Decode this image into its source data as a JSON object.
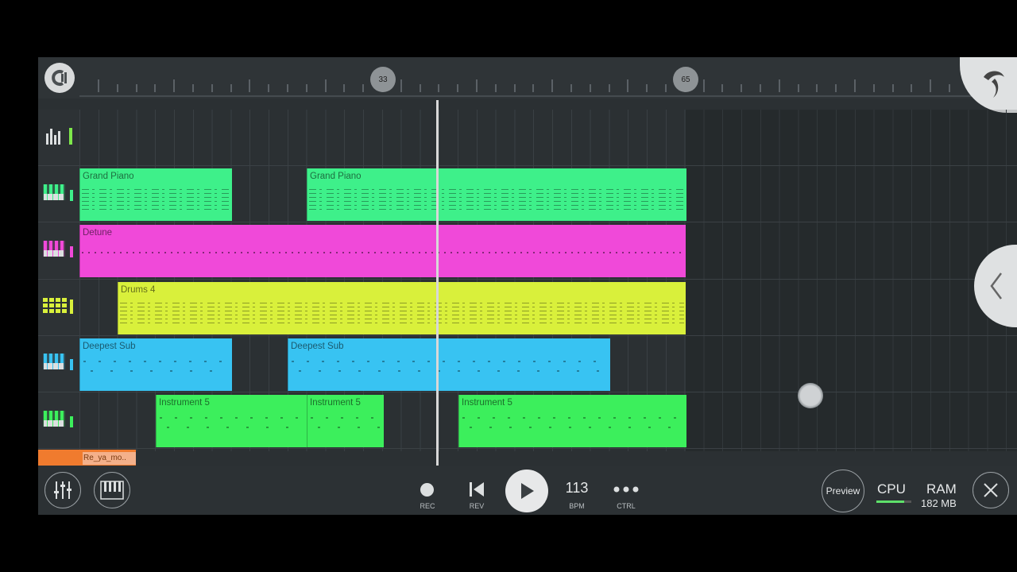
{
  "timeline": {
    "markers": [
      {
        "label": "33"
      },
      {
        "label": "65"
      }
    ]
  },
  "tracks": [
    {
      "icon": "mixer-icon",
      "color": "#7ee84b",
      "clips": []
    },
    {
      "icon": "piano-keys-icon",
      "color": "#3ef08a",
      "clips": [
        {
          "name": "Grand Piano",
          "style": "notes"
        },
        {
          "name": "Grand Piano",
          "style": "notes"
        }
      ]
    },
    {
      "icon": "piano-keys-icon",
      "color": "#f049d9",
      "clips": [
        {
          "name": "Detune",
          "style": "dots"
        }
      ]
    },
    {
      "icon": "drum-pads-icon",
      "color": "#d9f03b",
      "clips": [
        {
          "name": "Drums 4",
          "style": "notes"
        }
      ]
    },
    {
      "icon": "piano-keys-icon",
      "color": "#38c3f2",
      "clips": [
        {
          "name": "Deepest Sub",
          "style": "scatter"
        },
        {
          "name": "Deepest Sub",
          "style": "scatter"
        }
      ]
    },
    {
      "icon": "piano-keys-icon",
      "color": "#3cef5c",
      "clips": [
        {
          "name": "Instrument 5",
          "style": "scatter"
        },
        {
          "name": "Instrument 5",
          "style": "scatter"
        },
        {
          "name": "Instrument 5",
          "style": "scatter"
        }
      ]
    }
  ],
  "audio_clip": {
    "name": "Re_ya_mo..",
    "color": "#f07b2e"
  },
  "transport": {
    "rec_label": "REC",
    "rev_label": "REV",
    "bpm_value": "113",
    "bpm_label": "BPM",
    "ctrl_label": "CTRL"
  },
  "status": {
    "preview_label": "Preview",
    "cpu_label": "CPU",
    "ram_label": "RAM",
    "ram_value": "182 MB"
  }
}
